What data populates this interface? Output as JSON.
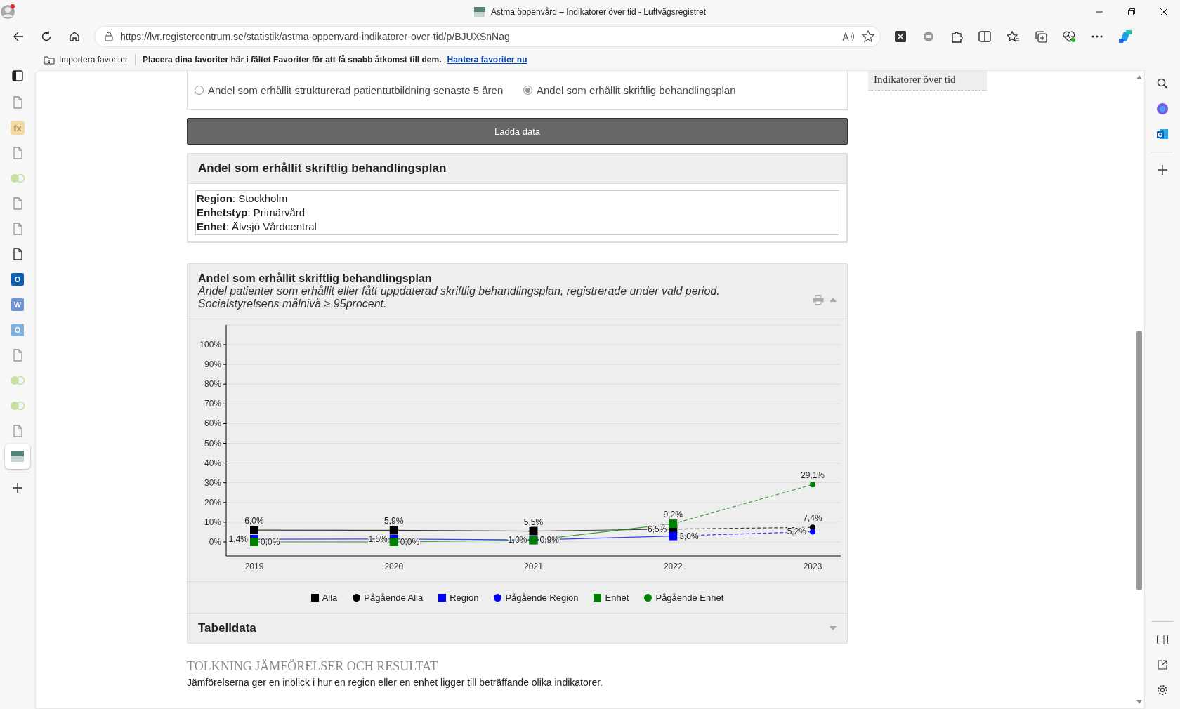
{
  "window": {
    "title": "Astma öppenvård – Indikatorer över tid - Luftvägsregistret"
  },
  "toolbar": {
    "url": "https://lvr.registercentrum.se/statistik/astma-oppenvard-indikatorer-over-tid/p/BJUXSnNag"
  },
  "favorites_bar": {
    "import_label": "Importera favoriter",
    "hint": "Placera dina favoriter här i fältet Favoriter för att få snabb åtkomst till dem.",
    "link": "Hantera favoriter nu"
  },
  "vertical_tabs": [
    {
      "kind": "page",
      "selected": false
    },
    {
      "kind": "fx",
      "label": "fx",
      "selected": false
    },
    {
      "kind": "page",
      "selected": false
    },
    {
      "kind": "toggle",
      "selected": false
    },
    {
      "kind": "page",
      "selected": false
    },
    {
      "kind": "page",
      "selected": false
    },
    {
      "kind": "page-dark",
      "selected": false
    },
    {
      "kind": "mail",
      "label": "O",
      "selected": false
    },
    {
      "kind": "doc",
      "label": "W",
      "selected": false
    },
    {
      "kind": "mail-light",
      "label": "O",
      "selected": false
    },
    {
      "kind": "page",
      "selected": false
    },
    {
      "kind": "toggle",
      "selected": false
    },
    {
      "kind": "toggle",
      "selected": false
    },
    {
      "kind": "page",
      "selected": false
    },
    {
      "kind": "site",
      "selected": true
    }
  ],
  "indicator_options": [
    {
      "label": "Andel som erhållit strukturerad patientutbildning senaste 5 åren",
      "selected": false
    },
    {
      "label": "Andel som erhållit skriftlig behandlingsplan",
      "selected": true
    }
  ],
  "load_button": "Ladda data",
  "selection_panel": {
    "title": "Andel som erhållit skriftlig behandlingsplan",
    "fields": [
      "**Region**: Stockholm",
      "**Enhetstyp**: Primärvård",
      "**Enhet**: Älvsjö Vårdcentral"
    ]
  },
  "chart_panel": {
    "title": "Andel som erhållit skriftlig behandlingsplan",
    "description": "Andel patienter som erhållit eller fått uppdaterad skriftlig behandlingsplan, registrerade under vald period. Socialstyrelsens målnivå ≥ 95procent.",
    "chart_data": {
      "type": "line",
      "grid": true,
      "categories": [
        "2019",
        "2020",
        "2021",
        "2022",
        "2023"
      ],
      "ylim": [
        0,
        110
      ],
      "yticks": [
        {
          "value": 0,
          "label": "0%"
        },
        {
          "value": 10,
          "label": "10%"
        },
        {
          "value": 20,
          "label": "20%"
        },
        {
          "value": 30,
          "label": "30%"
        },
        {
          "value": 40,
          "label": "40%"
        },
        {
          "value": 50,
          "label": "50%"
        },
        {
          "value": 60,
          "label": "60%"
        },
        {
          "value": 70,
          "label": "70%"
        },
        {
          "value": 80,
          "label": "80%"
        },
        {
          "value": 90,
          "label": "90%"
        },
        {
          "value": 100,
          "label": "100%"
        }
      ],
      "series": [
        {
          "name": "Alla",
          "marker": "square",
          "line_style": "solid",
          "color": "#000000",
          "values": [
            6.0,
            5.9,
            5.5,
            6.5,
            null
          ],
          "value_labels": [
            "6,0%",
            "5,9%",
            "5,5%",
            "6,5%",
            null
          ]
        },
        {
          "name": "Pågående Alla",
          "marker": "circle",
          "line_style": "dashed",
          "color": "#000000",
          "values": [
            null,
            null,
            null,
            6.5,
            7.4
          ],
          "value_labels": [
            null,
            null,
            null,
            null,
            "7,4%"
          ]
        },
        {
          "name": "Region",
          "marker": "square",
          "line_style": "solid",
          "color": "#0000ff",
          "values": [
            1.4,
            1.5,
            1.0,
            3.0,
            null
          ],
          "value_labels": [
            "1,4%",
            "1,5%",
            "1,0%",
            "3,0%",
            null
          ]
        },
        {
          "name": "Pågående Region",
          "marker": "circle",
          "line_style": "dashed",
          "color": "#0000ff",
          "values": [
            null,
            null,
            null,
            3.0,
            5.2
          ],
          "value_labels": [
            null,
            null,
            null,
            null,
            "5,2%"
          ]
        },
        {
          "name": "Enhet",
          "marker": "square",
          "line_style": "solid",
          "color": "#008000",
          "values": [
            0.0,
            0.0,
            0.9,
            9.2,
            null
          ],
          "value_labels": [
            "0,0%",
            "0,0%",
            "0,9%",
            "9,2%",
            null
          ]
        },
        {
          "name": "Pågående Enhet",
          "marker": "circle",
          "line_style": "dashed",
          "color": "#008000",
          "values": [
            null,
            null,
            null,
            9.2,
            29.1
          ],
          "value_labels": [
            null,
            null,
            null,
            null,
            "29,1%"
          ]
        }
      ]
    }
  },
  "table_section": {
    "title": "Tabelldata",
    "expanded": false
  },
  "interpretation": {
    "heading": "TOLKNING JÄMFÖRELSER OCH RESULTAT",
    "text": "Jämförelserna ger en inblick i hur en region eller en enhet ligger till beträffande olika indikatorer."
  },
  "aside": {
    "title": "Indikatorer över tid"
  }
}
